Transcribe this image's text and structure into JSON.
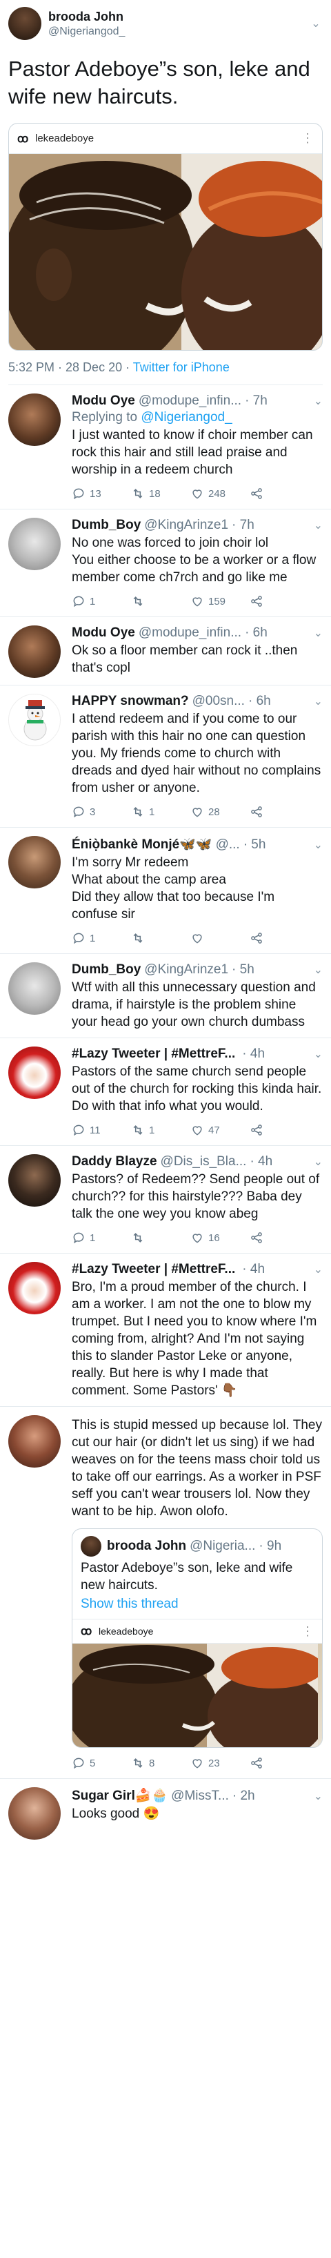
{
  "colors": {
    "link": "#1da1f2",
    "muted": "#657786",
    "text": "#14171a",
    "border": "#e6ecf0"
  },
  "main": {
    "name": "brooda John",
    "handle": "@Nigeriangod_",
    "text": "Pastor Adeboye”s son, leke and wife new haircuts.",
    "ig_user": "lekeadeboye",
    "ig_logo": "ꝏ",
    "time": "5:32 PM · 28 Dec 20 · ",
    "source": "Twitter for iPhone"
  },
  "icons": {
    "reply": "reply-icon",
    "retweet": "retweet-icon",
    "like": "heart-icon",
    "share": "share-icon",
    "chevron": "chevron-down-icon",
    "dots": "more-icon"
  },
  "replies": [
    {
      "name": "Modu Oye",
      "handle": "@modupe_infin...",
      "time": "· 7h",
      "replying_label": "Replying to ",
      "replying_to": "@Nigeriangod_",
      "text": "I just wanted to know if  choir member can rock this hair and still lead praise and worship in a redeem church",
      "replies": "13",
      "retweets": "18",
      "likes": "248"
    },
    {
      "name": "Dumb_Boy",
      "handle": "@KingArinze1",
      "time": "· 7h",
      "text": "No one was forced to join choir lol\nYou either choose to be a worker or a flow member come ch7rch and go like me",
      "replies": "1",
      "retweets": "",
      "likes": "159"
    },
    {
      "name": "Modu Oye",
      "handle": "@modupe_infin...",
      "time": "· 6h",
      "text": "Ok so a floor member can rock it ..then that's copl",
      "replies": "",
      "retweets": "",
      "likes": ""
    },
    {
      "name": "HAPPY snowman?",
      "handle": "@00sn...",
      "time": "· 6h",
      "text": "I attend redeem and if you come to our parish with this hair no one can question you. My friends come to church with dreads and dyed hair without no complains from usher or anyone.",
      "replies": "3",
      "retweets": "1",
      "likes": "28"
    },
    {
      "name": "Éniọ̀bankè Monjé🦋🦋",
      "handle": "@...",
      "time": "· 5h",
      "text": "I'm sorry Mr redeem\nWhat about the camp area\nDid they allow that too because I'm confuse sir",
      "replies": "1",
      "retweets": "",
      "likes": ""
    },
    {
      "name": "Dumb_Boy",
      "handle": "@KingArinze1",
      "time": "· 5h",
      "text": "Wtf with all this unnecessary question and drama, if hairstyle is the problem shine your head go your own church dumbass",
      "replies": "",
      "retweets": "",
      "likes": ""
    },
    {
      "name": "#Lazy Tweeter | #MettreF...",
      "handle": "",
      "time": "· 4h",
      "text": "Pastors of the same church send people out of the church for rocking this kinda hair. Do with that info what you would.",
      "replies": "11",
      "retweets": "1",
      "likes": "47"
    },
    {
      "name": "Daddy Blayze",
      "handle": "@Dis_is_Bla...",
      "time": "· 4h",
      "text": "Pastors? of Redeem?? Send people out of church?? for this hairstyle??? Baba dey talk the one wey you know abeg",
      "replies": "1",
      "retweets": "",
      "likes": "16"
    },
    {
      "name": "#Lazy Tweeter | #MettreF...",
      "handle": "",
      "time": "· 4h",
      "text": "Bro, I'm a proud member of the church. I am a worker. I am not the one to blow my trumpet. But I need you to know where I'm coming from, alright? And I'm not saying this to slander Pastor Leke or anyone, really. But here is why I made that comment. Some Pastors' 👇🏾",
      "replies": "",
      "retweets": "",
      "likes": ""
    },
    {
      "name": "",
      "handle": "",
      "time": "",
      "text": "This is stupid messed up because lol. They cut our hair (or didn't let us sing) if we had weaves on for the teens mass choir told us to take off our earrings. As a worker in PSF seff you can't wear trousers lol. Now they want to be hip. Awon olofo.",
      "quoted": {
        "name": "brooda John",
        "handle": "@Nigeria...",
        "time": "· 9h",
        "text": "Pastor Adeboye”s son, leke and wife new haircuts.",
        "link": "Show this thread",
        "ig_user": "lekeadeboye"
      },
      "replies": "5",
      "retweets": "8",
      "likes": "23"
    },
    {
      "name": "Sugar Girl🍰🧁",
      "handle": "@MissT...",
      "time": "· 2h",
      "text": "Looks good 😍",
      "replies": "",
      "retweets": "",
      "likes": ""
    }
  ]
}
